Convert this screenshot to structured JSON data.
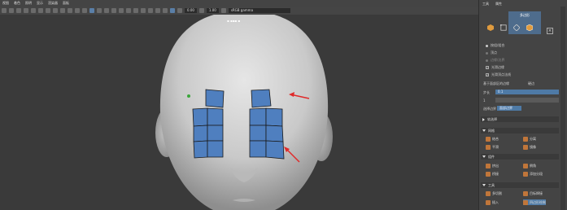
{
  "menu": [
    "视图",
    "着色",
    "照明",
    "显示",
    "渲染器",
    "面板"
  ],
  "toolbar": {
    "field1": "0.00",
    "field2": "1.00",
    "color_space": "sRGB gamma",
    "hud_text": "▪ ▪▪▪ ▪"
  },
  "panel": {
    "tabs": [
      "工具",
      "属性"
    ],
    "shelf_title": "多边形",
    "options": [
      {
        "label": "按组/组合",
        "type": "radio",
        "on": true
      },
      {
        "label": "顶点",
        "type": "radio",
        "on": false
      },
      {
        "label": "边缘/边界",
        "type": "radio",
        "on": false
      },
      {
        "label": "光滑边缘",
        "type": "check",
        "on": true
      },
      {
        "label": "光滑顶点法线",
        "type": "check",
        "on": true
      }
    ],
    "convert_label": "基于面部区的边缘",
    "convert_value": "硬边",
    "step_label": "步长",
    "step_value": "0.1",
    "step_value2": "1",
    "pick_label": "选择边界",
    "pick_value": "面部边界",
    "soft_select": "软选择",
    "sections": [
      "网格",
      "组件",
      "工具"
    ],
    "mesh_tools": [
      "结合",
      "分离",
      "平滑",
      "镜像"
    ],
    "component_tools": [
      "挤出",
      "倒角",
      "桥接",
      "添加分段"
    ],
    "utility_tools": [
      "多切割",
      "目标焊接",
      "插入",
      "四边形绘制"
    ]
  }
}
